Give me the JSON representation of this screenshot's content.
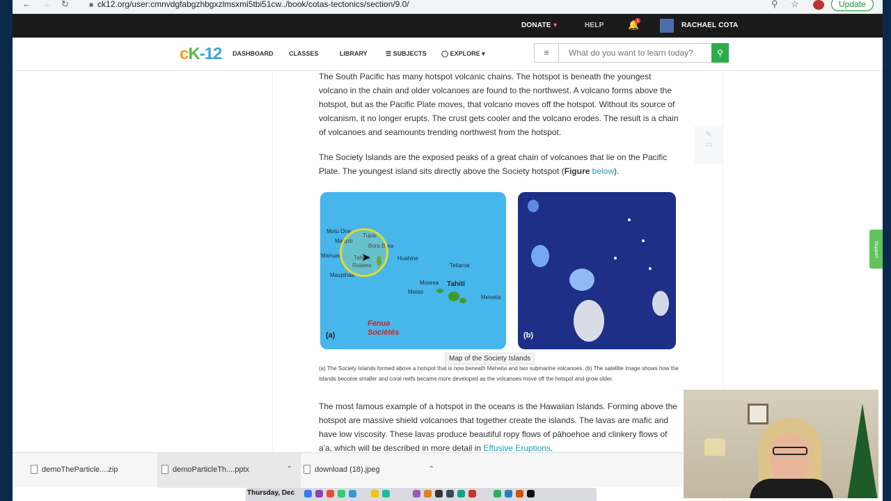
{
  "browser": {
    "url": "ck12.org/user:cmnvdgfabgzhbgxzlmsxmi5tbi51cw../book/cotas-tectonics/section/9.0/",
    "update_label": "Update"
  },
  "topbar": {
    "donate": "DONATE",
    "help": "HELP",
    "notification_count": "1",
    "user_name": "RACHAEL COTA"
  },
  "nav": {
    "logo": {
      "c": "c",
      "k": "K",
      "n": "-12"
    },
    "links": [
      "DASHBOARD",
      "CLASSES",
      "LIBRARY",
      "SUBJECTS",
      "EXPLORE"
    ],
    "search_placeholder": "What do you want to learn today?"
  },
  "content": {
    "para1": "The South Pacific has many hotspot volcanic chains. The hotspot is beneath the youngest volcano in the chain and older volcanoes are found to the northwest. A volcano forms above the hotspot, but as the Pacific Plate moves, that volcano moves off the hotspot. Without its source of volcanism, it no longer erupts. The crust gets cooler and the volcano erodes. The result is a chain of volcanoes and seamounts trending northwest from the hotspot.",
    "para2_text": "The Society Islands are the exposed peaks of a great chain of volcanoes that lie on the Pacific Plate. The youngest island sits directly above the Society hotspot (",
    "para2_bold": "Figure",
    "para2_link": "below",
    "para2_end": ").",
    "map_labels": {
      "motu_one": "Motu One",
      "tupai": "Tupai",
      "maupiti": "Maupiti",
      "bora_bora": "Bora Bora",
      "manuae": "Manuae",
      "tahaa": "Taha'a",
      "raiatea": "Raiatea",
      "huahine": "Huahine",
      "maupihaa": "Maupihaa",
      "tetiaroa": "Tetiaroa",
      "moorea": "Moorea",
      "tahiti": "Tahiti",
      "maiao": "Maiao",
      "mehetia": "Mehetia",
      "fenua_1": "Fenua",
      "fenua_2": "Sociétés"
    },
    "panel_a": "(a)",
    "panel_b": "(b)",
    "tooltip": "Map of the Society Islands",
    "caption": "(a) The Society Islands formed above a hotspot that is now beneath Mehetia and two submarine volcanoes. (b) The satellite image shows how the islands become smaller and coral reefs became more developed as the volcanoes move off the hotspot and grow older.",
    "para3_text": "The most famous example of a hotspot in the oceans is the Hawaiian Islands. Forming above the hotspot are massive shield volcanoes that together create the islands. The lavas are mafic and have low viscosity. These lavas produce beautiful ropy flows of pāhoehoe and clinkery flows of a'a, which will be described in more detail in ",
    "para3_link": "Effusive Eruptions",
    "para3_end": "."
  },
  "support_label": "Support",
  "downloads": [
    {
      "name": "demoTheParticle....zip"
    },
    {
      "name": "demoParticleTh....pptx"
    },
    {
      "name": "download (18).jpeg"
    }
  ],
  "dock": {
    "date": "Thursday, Dec"
  },
  "colors": {
    "accent_green": "#2bae4a",
    "link_blue": "#1a9bcb",
    "ocean": "#47b6ea"
  }
}
